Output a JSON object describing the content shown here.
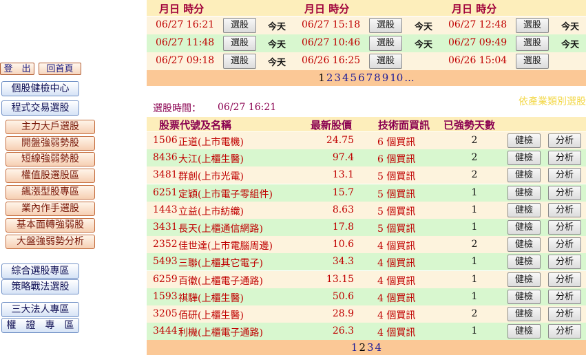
{
  "nav": {
    "logout": "登　出",
    "home": "回首頁",
    "health_center": "個股健檢中心",
    "program_trading": "程式交易選股",
    "sub_items": [
      "主力大戶選股",
      "開盤強弱勢股",
      "短線強弱勢股",
      "權值股選股區",
      "飆漲型股專區",
      "業內作手選股",
      "基本面轉強弱股",
      "大盤強弱勢分析"
    ],
    "combo": "綜合選股專區",
    "strategy": "策略戰法選股",
    "institutional": "三大法人專區",
    "warrants": "權　證　專　區"
  },
  "top_panel": {
    "header": [
      "月日 時分",
      "月日 時分",
      "月日 時分"
    ],
    "select_label": "選股",
    "today_label": "今天",
    "rows": [
      {
        "color": "#fdf3dd",
        "cells": [
          {
            "time": "06/27 16:21",
            "today": true
          },
          {
            "time": "06/27 15:18",
            "today": true
          },
          {
            "time": "06/27 12:48",
            "today": true
          }
        ]
      },
      {
        "color": "#d8f7cf",
        "cells": [
          {
            "time": "06/27 11:48",
            "today": true
          },
          {
            "time": "06/27 10:46",
            "today": true
          },
          {
            "time": "06/27 09:49",
            "today": true
          }
        ]
      },
      {
        "color": "#fdf3dd",
        "cells": [
          {
            "time": "06/27 09:18",
            "today": true
          },
          {
            "time": "06/26 16:25",
            "today": false
          },
          {
            "time": "06/26 15:04",
            "today": false
          }
        ]
      }
    ],
    "pages": [
      "1",
      "2",
      "3",
      "4",
      "5",
      "6",
      "7",
      "8",
      "9",
      "10",
      "..."
    ],
    "current_page": "1"
  },
  "industry_link": "依產業類別選股",
  "selection_time_label": "選股時間：",
  "selection_time": "06/27 16:21",
  "list_header": {
    "code_name": "股票代號及名稱",
    "price": "最新股價",
    "signals": "技術面買訊",
    "days": "已強勢天數"
  },
  "check_label": "健檢",
  "analyze_label": "分析",
  "row_colors": [
    "#fdf3dd",
    "#d8f7cf"
  ],
  "stocks": [
    {
      "code": "1506",
      "name": "正道(上市電機)",
      "price": "24.75",
      "signals": "6 個買訊",
      "days": "2"
    },
    {
      "code": "8436",
      "name": "大江(上櫃生醫)",
      "price": "97.4",
      "signals": "6 個買訊",
      "days": "2"
    },
    {
      "code": "3481",
      "name": "群創(上市光電)",
      "price": "13.1",
      "signals": "5 個買訊",
      "days": "2"
    },
    {
      "code": "6251",
      "name": "定穎(上市電子零組件)",
      "price": "15.7",
      "signals": "5 個買訊",
      "days": "1"
    },
    {
      "code": "1443",
      "name": "立益(上市紡織)",
      "price": "8.63",
      "signals": "5 個買訊",
      "days": "1"
    },
    {
      "code": "3431",
      "name": "長天(上櫃通信網路)",
      "price": "17.8",
      "signals": "5 個買訊",
      "days": "1"
    },
    {
      "code": "2352",
      "name": "佳世達(上市電腦周邊)",
      "price": "10.6",
      "signals": "4 個買訊",
      "days": "2"
    },
    {
      "code": "5493",
      "name": "三聯(上櫃其它電子)",
      "price": "34.3",
      "signals": "4 個買訊",
      "days": "1"
    },
    {
      "code": "6259",
      "name": "百徽(上櫃電子通路)",
      "price": "13.15",
      "signals": "4 個買訊",
      "days": "1"
    },
    {
      "code": "1593",
      "name": "祺驊(上櫃生醫)",
      "price": "50.6",
      "signals": "4 個買訊",
      "days": "1"
    },
    {
      "code": "3205",
      "name": "佰研(上櫃生醫)",
      "price": "28.9",
      "signals": "4 個買訊",
      "days": "2"
    },
    {
      "code": "3444",
      "name": "利機(上櫃電子通路)",
      "price": "26.3",
      "signals": "4 個買訊",
      "days": "1"
    }
  ],
  "bottom_pages": [
    "1",
    "2",
    "3",
    "4"
  ],
  "bottom_current": "2"
}
